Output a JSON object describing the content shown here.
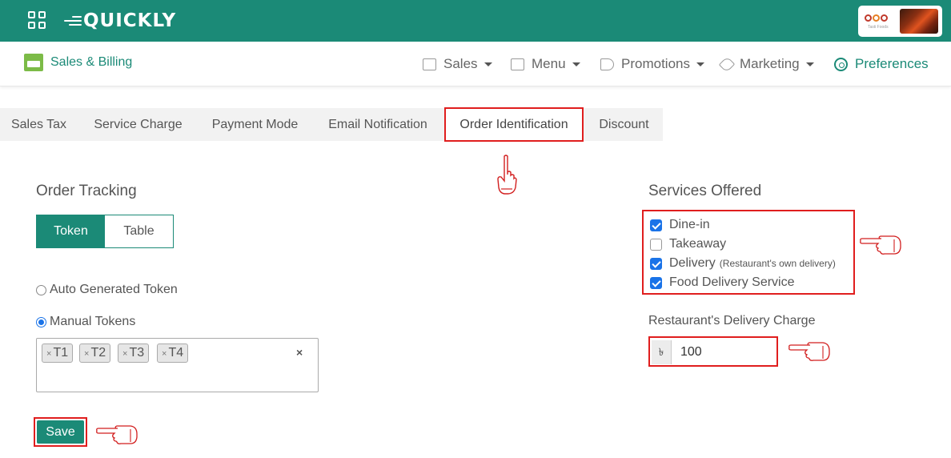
{
  "topbar": {
    "logo_text": "QUICKLY",
    "profile_subtitle": "Tasti Foods"
  },
  "nav": {
    "brand": "Sales & Billing",
    "items": [
      {
        "label": "Sales",
        "icon": "monitor-icon"
      },
      {
        "label": "Menu",
        "icon": "menu-list-icon"
      },
      {
        "label": "Promotions",
        "icon": "megaphone-icon"
      },
      {
        "label": "Marketing",
        "icon": "rocket-icon"
      },
      {
        "label": "Preferences",
        "icon": "gear-icon"
      }
    ],
    "accent_color": "#1b8a77"
  },
  "tabs": [
    {
      "label": "Sales Tax"
    },
    {
      "label": "Service Charge"
    },
    {
      "label": "Payment Mode"
    },
    {
      "label": "Email Notification"
    },
    {
      "label": "Order Identification",
      "active": true
    },
    {
      "label": "Discount"
    }
  ],
  "order_tracking": {
    "title": "Order Tracking",
    "modes": [
      "Token",
      "Table"
    ],
    "selected_mode": "Token",
    "options": [
      {
        "label": "Auto Generated Token",
        "selected": false
      },
      {
        "label": "Manual Tokens",
        "selected": true
      }
    ],
    "tokens": [
      "T1",
      "T2",
      "T3",
      "T4"
    ],
    "token_remove_glyph": "×",
    "clear_glyph": "×",
    "save_label": "Save"
  },
  "services": {
    "title": "Services Offered",
    "items": [
      {
        "label": "Dine-in",
        "checked": true,
        "note": ""
      },
      {
        "label": "Takeaway",
        "checked": false,
        "note": ""
      },
      {
        "label": "Delivery",
        "checked": true,
        "note": "(Restaurant's own delivery)"
      },
      {
        "label": "Food Delivery Service",
        "checked": true,
        "note": ""
      }
    ],
    "delivery_charge_label": "Restaurant's Delivery Charge",
    "currency_symbol": "৳",
    "delivery_charge_value": "100"
  },
  "highlight_color": "#e01e1e"
}
